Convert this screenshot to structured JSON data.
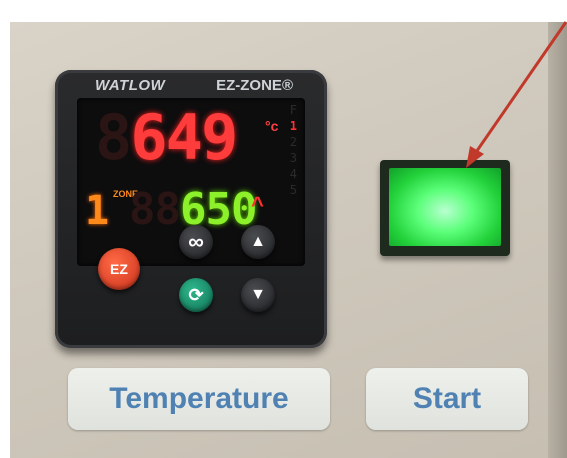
{
  "controller": {
    "brand_left": "WATLOW",
    "brand_right": "EZ-ZONE®",
    "process_value": "649",
    "process_ghost": "8",
    "unit": "°c",
    "side_indicators": [
      "F",
      "1",
      "2",
      "3",
      "4",
      "5"
    ],
    "active_indicator": "1",
    "zone_number": "1",
    "zone_label": "ZONE",
    "setpoint_value": "650",
    "setpoint_ghost": "88",
    "ramp_symbol": "^"
  },
  "buttons": {
    "ez_label": "EZ",
    "infinity_symbol": "∞",
    "cycle_symbol": "⟳",
    "up_symbol": "▲",
    "down_symbol": "▼"
  },
  "labels": {
    "temperature": "Temperature",
    "start": "Start"
  },
  "colors": {
    "process_red": "#ff3c3c",
    "setpoint_green": "#8cf02a",
    "start_green": "#22d13a",
    "arrow_red": "#c0392b",
    "label_blue": "#4f82b3"
  }
}
